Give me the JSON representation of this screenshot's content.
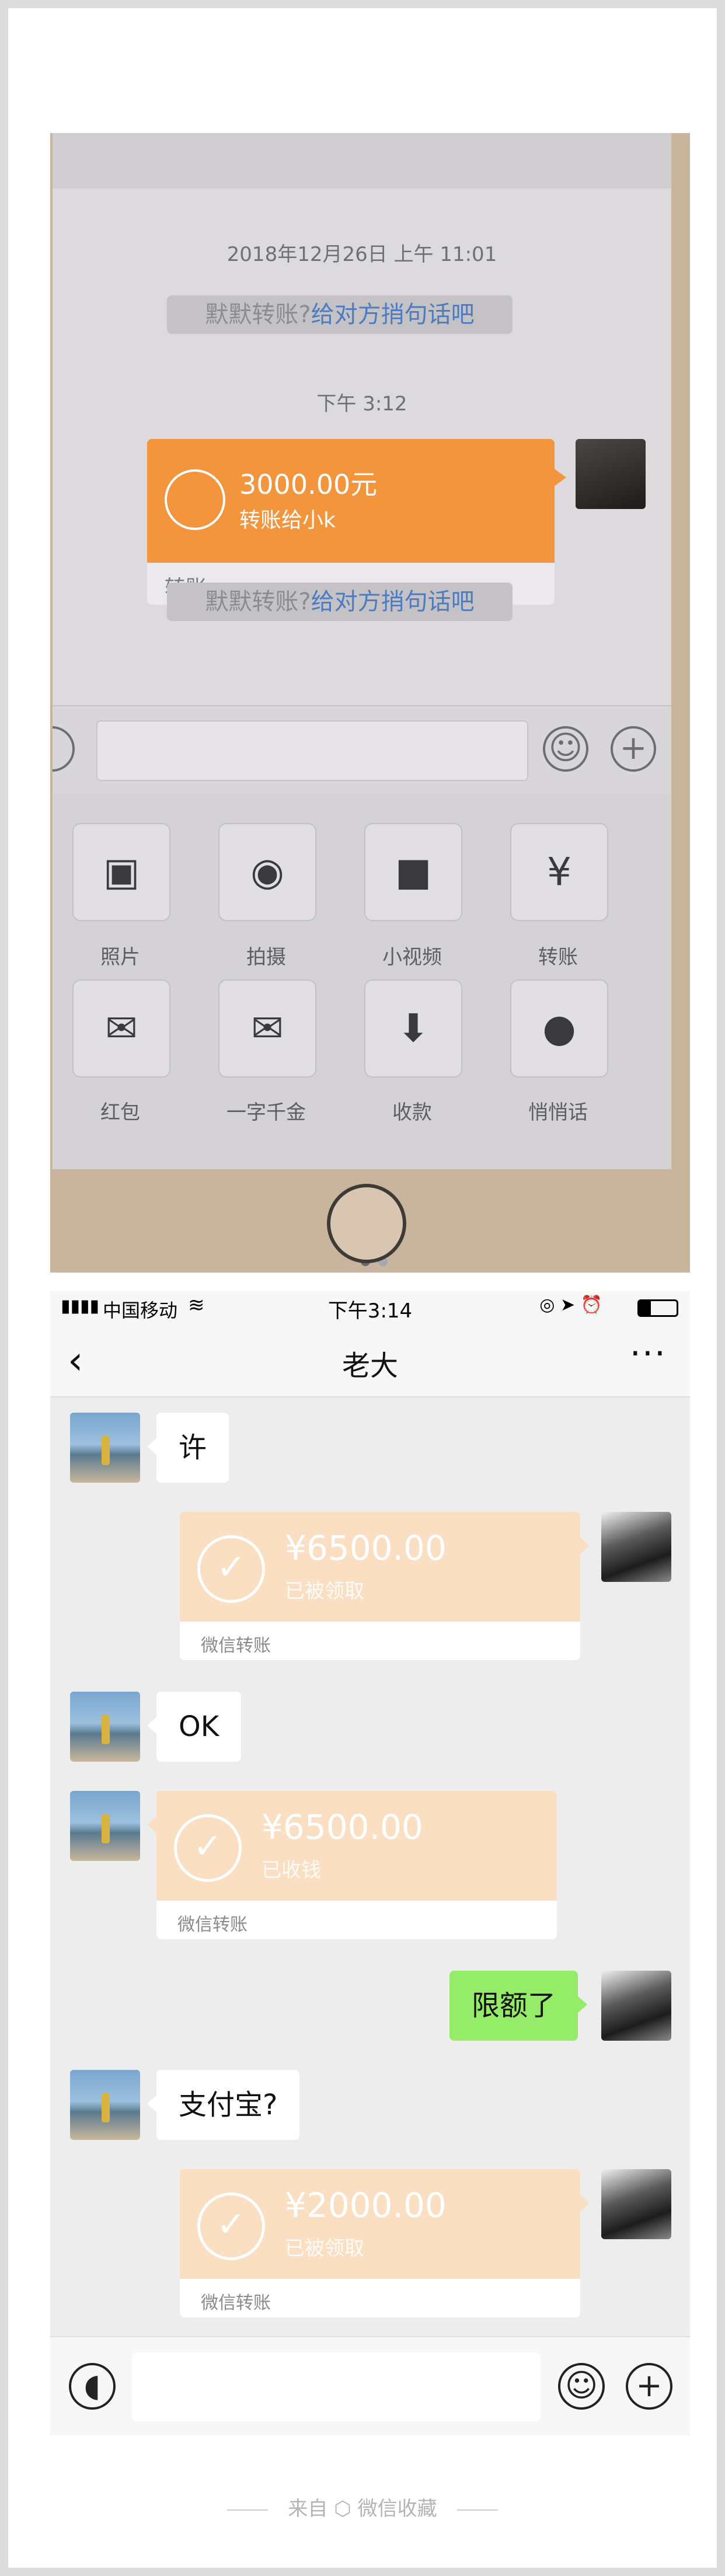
{
  "top_screenshot": {
    "datetime": "2018年12月26日 上午 11:01",
    "system_msg_1": {
      "text": "默默转账?",
      "link": "给对方捎句话吧"
    },
    "time_2": "下午 3:12",
    "transfer": {
      "amount": "3000.00元",
      "note": "转账给小k",
      "label": "转账"
    },
    "system_msg_2": {
      "text": "默默转账?",
      "link": "给对方捎句话吧"
    },
    "panel": [
      {
        "label": "照片",
        "icon": "photo-icon"
      },
      {
        "label": "拍摄",
        "icon": "camera-icon"
      },
      {
        "label": "小视频",
        "icon": "video-icon"
      },
      {
        "label": "转账",
        "icon": "transfer-icon"
      },
      {
        "label": "红包",
        "icon": "red-packet-icon"
      },
      {
        "label": "一字千金",
        "icon": "envelope-icon"
      },
      {
        "label": "收款",
        "icon": "receive-icon"
      },
      {
        "label": "悄悄话",
        "icon": "whisper-icon"
      }
    ]
  },
  "bottom_screenshot": {
    "status": {
      "carrier": "中国移动",
      "time": "下午3:14"
    },
    "title": "老大",
    "messages": [
      {
        "side": "left",
        "type": "text",
        "text": "许"
      },
      {
        "side": "right",
        "type": "transfer",
        "amount": "¥6500.00",
        "status": "已被领取",
        "label": "微信转账"
      },
      {
        "side": "left",
        "type": "text",
        "text": "OK"
      },
      {
        "side": "left",
        "type": "transfer",
        "amount": "¥6500.00",
        "status": "已收钱",
        "label": "微信转账"
      },
      {
        "side": "right",
        "type": "text",
        "text": "限额了"
      },
      {
        "side": "left",
        "type": "text",
        "text": "支付宝?"
      },
      {
        "side": "right",
        "type": "transfer",
        "amount": "¥2000.00",
        "status": "已被领取",
        "label": "微信转账"
      }
    ]
  },
  "footer": {
    "prefix": "来自",
    "source": "微信收藏"
  },
  "colors": {
    "transfer_orange": "#f3953d",
    "transfer_received": "#fbdfc3",
    "green_bubble": "#95ec69",
    "link_blue": "#4c7bbf"
  }
}
